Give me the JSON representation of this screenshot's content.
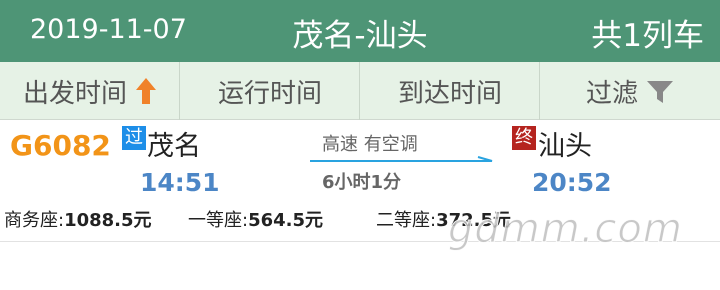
{
  "header": {
    "date": "2019-11-07",
    "route": "茂名-汕头",
    "count": "共1列车",
    "background": "#4e9576"
  },
  "sortbar": {
    "depart_label": "出发时间",
    "depart_sort_icon": "sort-ascending-arrow-icon",
    "run_label": "运行时间",
    "arrive_label": "到达时间",
    "filter_label": "过滤",
    "filter_icon": "funnel-icon"
  },
  "trains": [
    {
      "number": "G6082",
      "from_tag": "过",
      "from_station": "茂名",
      "to_tag": "终",
      "to_station": "汕头",
      "depart_time": "14:51",
      "arrive_time": "20:52",
      "type": "高速  有空调",
      "duration": "6小时1分",
      "seats": [
        {
          "name": "商务座:",
          "price": "1088.5元"
        },
        {
          "name": "一等座:",
          "price": "564.5元"
        },
        {
          "name": "二等座:",
          "price": "372.5元"
        }
      ]
    }
  ],
  "colors": {
    "train_number": "#f29418",
    "time": "#4c86c6",
    "tag_pass": "#1d8ee8",
    "tag_end": "#b5241f",
    "route_line": "#29a3e0"
  },
  "watermark": "gdmm.com"
}
